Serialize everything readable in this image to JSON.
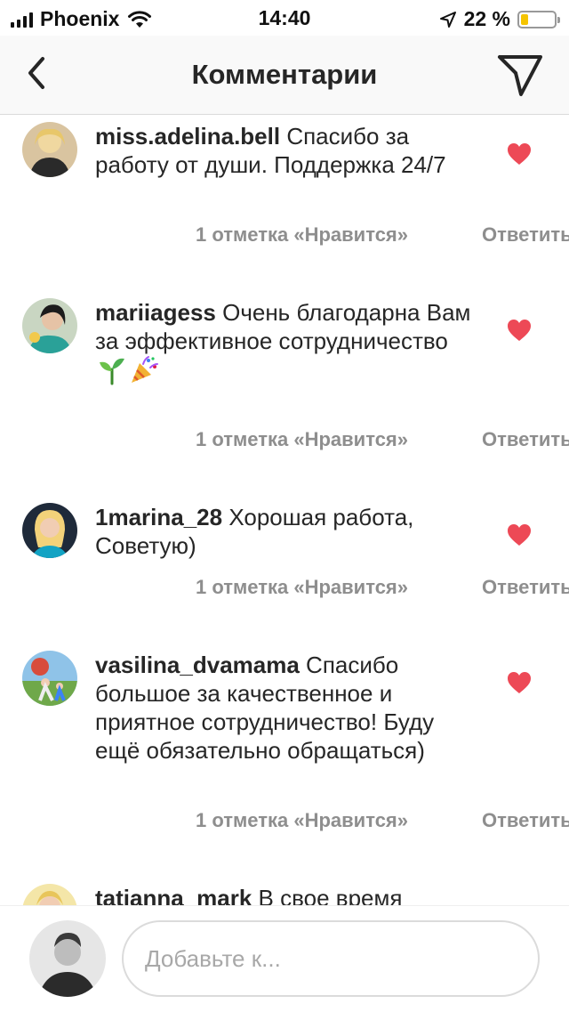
{
  "status": {
    "carrier": "Phoenix",
    "time": "14:40",
    "battery": "22 %",
    "battery_level": 0.22
  },
  "nav": {
    "title": "Комментарии"
  },
  "comments": [
    {
      "username": "miss.adelina.bell",
      "text": " Спасибо за работу от души. Поддержка 24/7",
      "likes": "1 отметка «Нравится»",
      "reply": "Ответить",
      "liked": true
    },
    {
      "username": "mariiagess",
      "text": " Очень благодарна Вам за эффективное сотрудничество ",
      "emoji": [
        "seedling-emoji",
        "party-popper-emoji"
      ],
      "likes": "1 отметка «Нравится»",
      "reply": "Ответить",
      "liked": true
    },
    {
      "username": "1marina_28",
      "text": " Хорошая работа, Советую)",
      "likes": "1 отметка «Нравится»",
      "reply": "Ответить",
      "liked": true
    },
    {
      "username": "vasilina_dvamama",
      "text": " Спасибо большое за качественное и приятное сотрудничество! Буду ещё обязательно обращаться)",
      "likes": "1 отметка «Нравится»",
      "reply": "Ответить",
      "liked": true
    },
    {
      "username": "tatianna_mark",
      "text": " В свое время",
      "liked": false
    }
  ],
  "composer": {
    "placeholder": "Добавьте к..."
  },
  "colors": {
    "heart": "#ed4956",
    "meta_text": "#8e8e8e",
    "battery_fill": "#f5c400"
  }
}
